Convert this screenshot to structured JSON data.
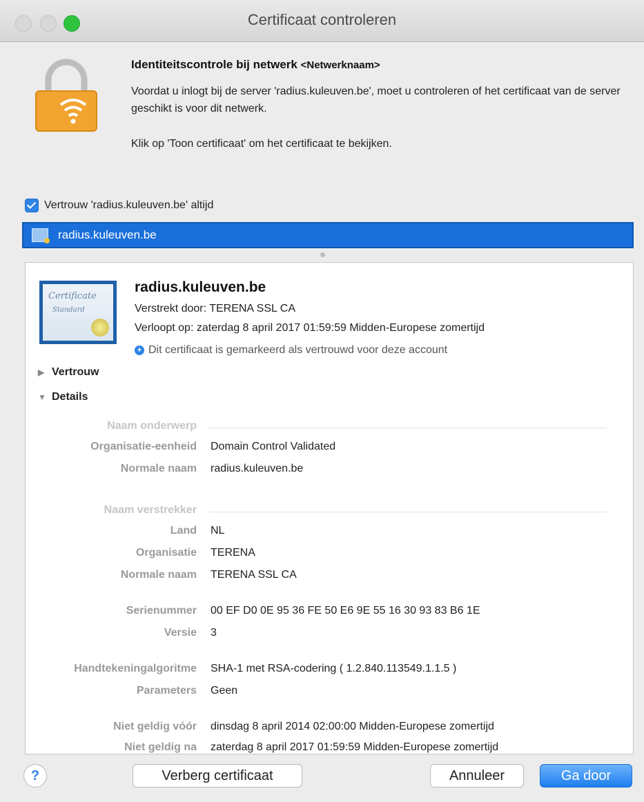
{
  "window": {
    "title": "Certificaat controleren"
  },
  "header": {
    "heading": "Identiteitscontrole bij netwerk",
    "network_placeholder": "<Netwerknaam>",
    "description": "Voordat u inlogt bij de server 'radius.kuleuven.be', moet u controleren of het certificaat van de server geschikt is voor dit netwerk.",
    "hint": "Klik op 'Toon certificaat' om het certificaat te bekijken."
  },
  "trust_checkbox": {
    "label": "Vertrouw 'radius.kuleuven.be' altijd",
    "checked": true
  },
  "cert_list": {
    "selected": "radius.kuleuven.be"
  },
  "certificate": {
    "name": "radius.kuleuven.be",
    "issued_by": "Verstrekt door: TERENA SSL CA",
    "expires": "Verloopt op: zaterdag 8 april 2017 01:59:59 Midden-Europese zomertijd",
    "status": "Dit certificaat is gemarkeerd als vertrouwd voor deze account",
    "icon_text": {
      "title": "Certificate",
      "subtitle": "Standard"
    }
  },
  "sections": {
    "trust": "Vertrouw",
    "details": "Details"
  },
  "details": {
    "subject_header": "Naam onderwerp",
    "org_unit_label": "Organisatie-eenheid",
    "org_unit_value": "Domain Control Validated",
    "common_name_label": "Normale naam",
    "common_name_value": "radius.kuleuven.be",
    "issuer_header": "Naam verstrekker",
    "country_label": "Land",
    "country_value": "NL",
    "organization_label": "Organisatie",
    "organization_value": "TERENA",
    "issuer_cn_label": "Normale naam",
    "issuer_cn_value": "TERENA SSL CA",
    "serial_label": "Serienummer",
    "serial_value": "00 EF D0 0E 95 36 FE 50 E6 9E 55 16 30 93 83 B6 1E",
    "version_label": "Versie",
    "version_value": "3",
    "sig_alg_label": "Handtekeningalgoritme",
    "sig_alg_value": "SHA-1 met RSA-codering ( 1.2.840.113549.1.1.5 )",
    "params_label": "Parameters",
    "params_value": "Geen",
    "not_before_label": "Niet geldig vóór",
    "not_before_value": "dinsdag 8 april 2014 02:00:00 Midden-Europese zomertijd",
    "not_after_label": "Niet geldig na",
    "not_after_value": "zaterdag 8 april 2017 01:59:59 Midden-Europese zomertijd"
  },
  "buttons": {
    "help": "?",
    "hide_certificate": "Verberg certificaat",
    "cancel": "Annuleer",
    "continue": "Ga door"
  },
  "colors": {
    "accent": "#1a6fdb",
    "primary_button": "#1e7ef0",
    "zoom_light": "#2fc440"
  },
  "icons": [
    "lock-wifi-icon",
    "certificate-icon",
    "info-icon",
    "disclosure-triangle-icon",
    "help-icon"
  ]
}
